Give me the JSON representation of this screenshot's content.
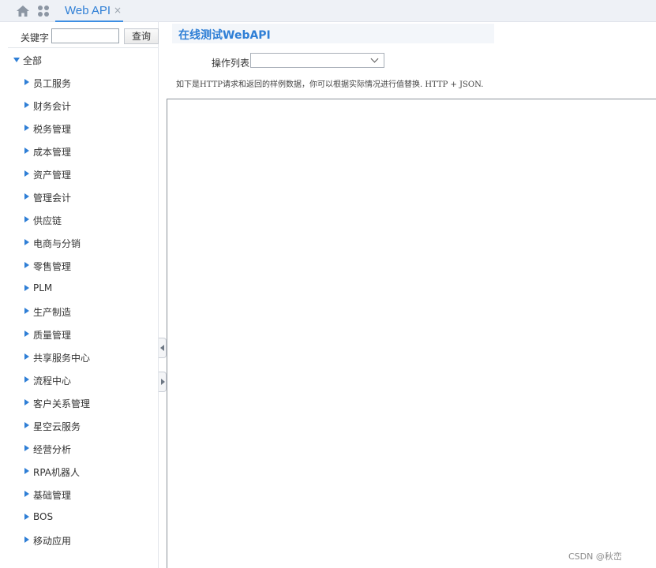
{
  "header": {
    "home_icon": "home-icon",
    "apps_icon": "apps-grid-icon",
    "tab": {
      "label": "Web API",
      "close": "×"
    }
  },
  "sidebar": {
    "search": {
      "label": "关键字",
      "value": "",
      "button": "查询"
    },
    "root": {
      "label": "全部",
      "expanded": true
    },
    "items": [
      {
        "label": "员工服务"
      },
      {
        "label": "财务会计"
      },
      {
        "label": "税务管理"
      },
      {
        "label": "成本管理"
      },
      {
        "label": "资产管理"
      },
      {
        "label": "管理会计"
      },
      {
        "label": "供应链"
      },
      {
        "label": "电商与分销"
      },
      {
        "label": "零售管理"
      },
      {
        "label": "PLM"
      },
      {
        "label": "生产制造"
      },
      {
        "label": "质量管理"
      },
      {
        "label": "共享服务中心"
      },
      {
        "label": "流程中心"
      },
      {
        "label": "客户关系管理"
      },
      {
        "label": "星空云服务"
      },
      {
        "label": "经营分析"
      },
      {
        "label": "RPA机器人"
      },
      {
        "label": "基础管理"
      },
      {
        "label": "BOS"
      },
      {
        "label": "移动应用"
      }
    ]
  },
  "main": {
    "title": "在线测试WebAPI",
    "operation": {
      "label": "操作列表",
      "value": ""
    },
    "hint": "如下是HTTP请求和返回的样例数据，你可以根据实际情况进行值替换. HTTP + JSON."
  },
  "watermark": "CSDN @秋峦",
  "colors": {
    "accent": "#2f7fd6",
    "tab_bar": "#eef1f6"
  }
}
